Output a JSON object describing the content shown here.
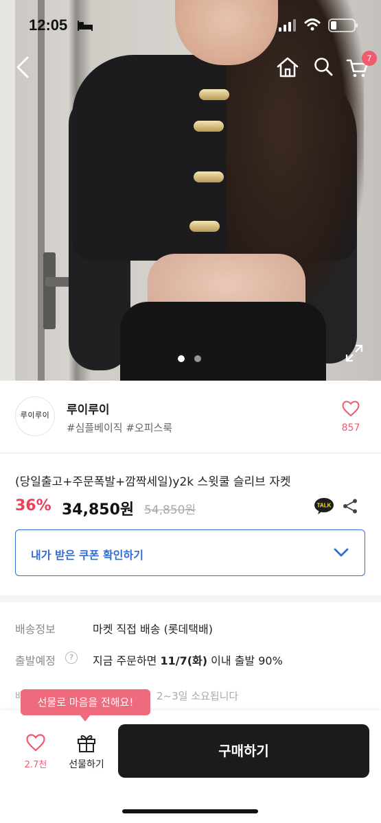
{
  "status_bar": {
    "time": "12:05"
  },
  "nav": {
    "cart_count": "7"
  },
  "shop": {
    "logo_text": "루이루이",
    "name": "루이루이",
    "tags": "#심플베이직 #오피스룩",
    "like_count": "857"
  },
  "product": {
    "title": "(당일출고+주문폭발+깜짝세일)y2k 스윗쿨 슬리브 자켓",
    "discount": "36%",
    "price": "34,850원",
    "original_price": "54,850원",
    "talk_label": "TALK"
  },
  "coupon": {
    "label": "내가 받은 쿠폰 확인하기"
  },
  "shipping": {
    "info_label": "배송정보",
    "info_value": "마켓 직접 배송 (롯데택배)",
    "eta_label": "출발예정",
    "eta_prefix": "지금 주문하면 ",
    "eta_date": "11/7(화)",
    "eta_suffix": " 이내 출발 90%",
    "faded_prefix": "배",
    "faded_text": "2~3일 소요됩니다"
  },
  "tooltip": {
    "text": "선물로 마음을 전해요!"
  },
  "bottom_bar": {
    "like_count": "2.7천",
    "gift_label": "선물하기",
    "buy_label": "구매하기"
  },
  "colors": {
    "accent_pink": "#ef5a6f",
    "accent_blue": "#2f6ed6",
    "dark_button": "#1b1b1b"
  }
}
